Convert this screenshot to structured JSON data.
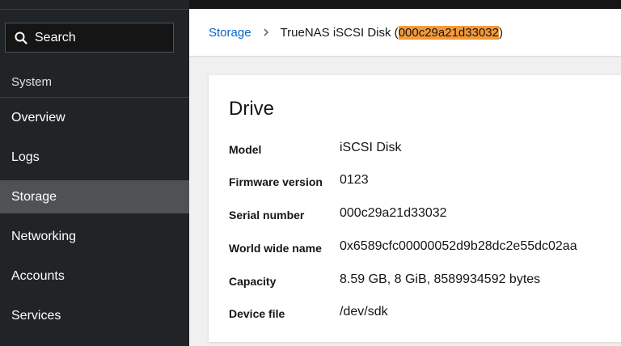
{
  "sidebar": {
    "search_label": "Search",
    "section_title": "System",
    "items": [
      {
        "label": "Overview"
      },
      {
        "label": "Logs"
      },
      {
        "label": "Storage"
      },
      {
        "label": "Networking"
      },
      {
        "label": "Accounts"
      },
      {
        "label": "Services"
      }
    ],
    "active_item": "Storage"
  },
  "breadcrumb": {
    "parent": "Storage",
    "current_prefix": "TrueNAS iSCSI Disk (",
    "current_serial": "000c29a21d33032",
    "current_suffix": ")"
  },
  "drive": {
    "title": "Drive",
    "fields": [
      {
        "label": "Model",
        "value": "iSCSI Disk"
      },
      {
        "label": "Firmware version",
        "value": "0123"
      },
      {
        "label": "Serial number",
        "value": "000c29a21d33032"
      },
      {
        "label": "World wide name",
        "value": "0x6589cfc00000052d9b28dc2e55dc02aa"
      },
      {
        "label": "Capacity",
        "value": "8.59 GB, 8 GiB, 8589934592 bytes"
      },
      {
        "label": "Device file",
        "value": "/dev/sdk"
      }
    ]
  },
  "colors": {
    "sidebar_bg": "#212427",
    "active_item_bg": "#4f5255",
    "link": "#0066cc",
    "highlight": "#f59a3a"
  }
}
